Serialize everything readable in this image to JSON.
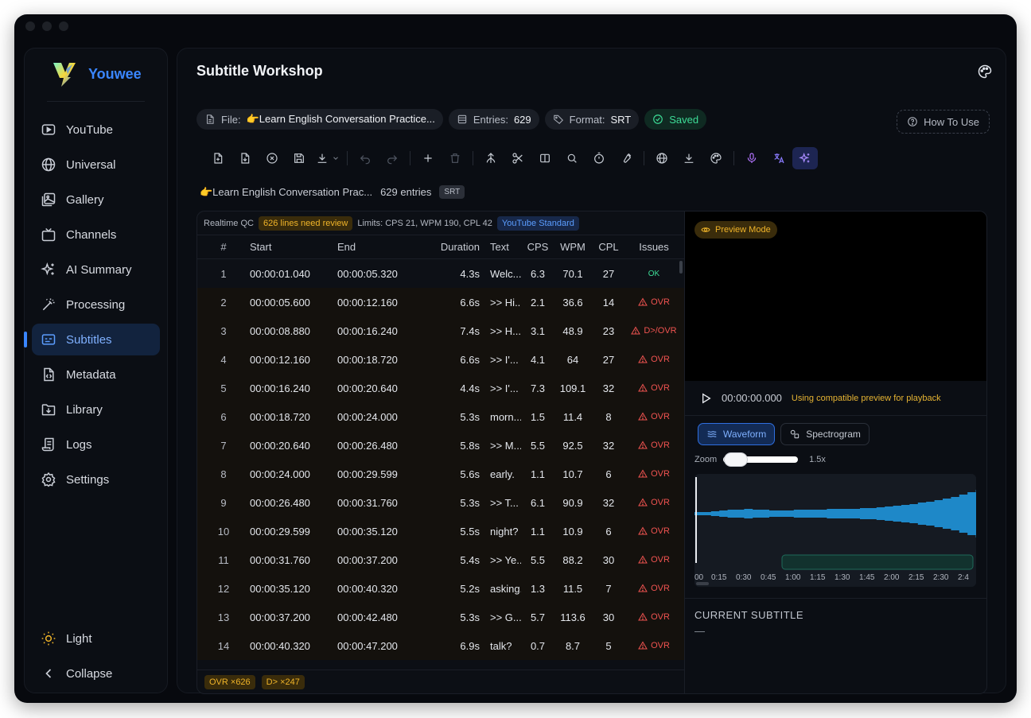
{
  "app": {
    "name": "Youwee",
    "page_title": "Subtitle Workshop"
  },
  "sidebar": {
    "items": [
      {
        "label": "YouTube",
        "icon": "play-square-icon"
      },
      {
        "label": "Universal",
        "icon": "globe-icon"
      },
      {
        "label": "Gallery",
        "icon": "image-icon"
      },
      {
        "label": "Channels",
        "icon": "tv-icon"
      },
      {
        "label": "AI Summary",
        "icon": "sparkles-icon"
      },
      {
        "label": "Processing",
        "icon": "wand-icon"
      },
      {
        "label": "Subtitles",
        "icon": "captions-icon",
        "active": true
      },
      {
        "label": "Metadata",
        "icon": "file-code-icon"
      },
      {
        "label": "Library",
        "icon": "folder-down-icon"
      },
      {
        "label": "Logs",
        "icon": "scroll-icon"
      },
      {
        "label": "Settings",
        "icon": "gear-icon"
      }
    ],
    "theme_label": "Light",
    "collapse_label": "Collapse"
  },
  "file_info": {
    "file_label": "File:",
    "file_value": "👉Learn English Conversation Practice...",
    "entries_label": "Entries:",
    "entries_value": "629",
    "format_label": "Format:",
    "format_value": "SRT",
    "status": "Saved"
  },
  "how_to_use": "How To Use",
  "subline": {
    "title": "👉Learn English Conversation Prac...",
    "count": "629 entries",
    "badge": "SRT"
  },
  "qc": {
    "label": "Realtime QC",
    "warning": "626 lines need review",
    "limits": "Limits: CPS 21, WPM 190, CPL 42",
    "standard": "YouTube Standard"
  },
  "table": {
    "headers": {
      "n": "#",
      "start": "Start",
      "end": "End",
      "duration": "Duration",
      "text": "Text",
      "cps": "CPS",
      "wpm": "WPM",
      "cpl": "CPL",
      "issues": "Issues"
    },
    "rows": [
      {
        "n": "1",
        "start": "00:00:01.040",
        "end": "00:00:05.320",
        "duration": "4.3s",
        "text": "Welc...",
        "cps": "6.3",
        "wpm": "70.1",
        "cpl": "27",
        "issue": "OK"
      },
      {
        "n": "2",
        "start": "00:00:05.600",
        "end": "00:00:12.160",
        "duration": "6.6s",
        "text": ">> Hi...",
        "cps": "2.1",
        "wpm": "36.6",
        "cpl": "14",
        "issue": "OVR"
      },
      {
        "n": "3",
        "start": "00:00:08.880",
        "end": "00:00:16.240",
        "duration": "7.4s",
        "text": ">> H...",
        "cps": "3.1",
        "wpm": "48.9",
        "cpl": "23",
        "issue": "D>/OVR"
      },
      {
        "n": "4",
        "start": "00:00:12.160",
        "end": "00:00:18.720",
        "duration": "6.6s",
        "text": ">> I'...",
        "cps": "4.1",
        "wpm": "64",
        "cpl": "27",
        "issue": "OVR"
      },
      {
        "n": "5",
        "start": "00:00:16.240",
        "end": "00:00:20.640",
        "duration": "4.4s",
        "text": ">> I'...",
        "cps": "7.3",
        "wpm": "109.1",
        "cpl": "32",
        "issue": "OVR"
      },
      {
        "n": "6",
        "start": "00:00:18.720",
        "end": "00:00:24.000",
        "duration": "5.3s",
        "text": "morn...",
        "cps": "1.5",
        "wpm": "11.4",
        "cpl": "8",
        "issue": "OVR"
      },
      {
        "n": "7",
        "start": "00:00:20.640",
        "end": "00:00:26.480",
        "duration": "5.8s",
        "text": ">> M...",
        "cps": "5.5",
        "wpm": "92.5",
        "cpl": "32",
        "issue": "OVR"
      },
      {
        "n": "8",
        "start": "00:00:24.000",
        "end": "00:00:29.599",
        "duration": "5.6s",
        "text": "early.",
        "cps": "1.1",
        "wpm": "10.7",
        "cpl": "6",
        "issue": "OVR"
      },
      {
        "n": "9",
        "start": "00:00:26.480",
        "end": "00:00:31.760",
        "duration": "5.3s",
        "text": ">> T...",
        "cps": "6.1",
        "wpm": "90.9",
        "cpl": "32",
        "issue": "OVR"
      },
      {
        "n": "10",
        "start": "00:00:29.599",
        "end": "00:00:35.120",
        "duration": "5.5s",
        "text": "night?",
        "cps": "1.1",
        "wpm": "10.9",
        "cpl": "6",
        "issue": "OVR"
      },
      {
        "n": "11",
        "start": "00:00:31.760",
        "end": "00:00:37.200",
        "duration": "5.4s",
        "text": ">> Ye...",
        "cps": "5.5",
        "wpm": "88.2",
        "cpl": "30",
        "issue": "OVR"
      },
      {
        "n": "12",
        "start": "00:00:35.120",
        "end": "00:00:40.320",
        "duration": "5.2s",
        "text": "asking.",
        "cps": "1.3",
        "wpm": "11.5",
        "cpl": "7",
        "issue": "OVR"
      },
      {
        "n": "13",
        "start": "00:00:37.200",
        "end": "00:00:42.480",
        "duration": "5.3s",
        "text": ">> G...",
        "cps": "5.7",
        "wpm": "113.6",
        "cpl": "30",
        "issue": "OVR"
      },
      {
        "n": "14",
        "start": "00:00:40.320",
        "end": "00:00:47.200",
        "duration": "6.9s",
        "text": "talk?",
        "cps": "0.7",
        "wpm": "8.7",
        "cpl": "5",
        "issue": "OVR"
      }
    ]
  },
  "footer_badges": [
    "OVR ×626",
    "D> ×247"
  ],
  "preview": {
    "mode": "Preview Mode",
    "time": "00:00:00.000",
    "note": "Using compatible preview for playback",
    "tabs": [
      "Waveform",
      "Spectrogram"
    ],
    "zoom_label": "Zoom",
    "zoom_value": "1.5x",
    "timeline": [
      "00",
      "0:15",
      "0:30",
      "0:45",
      "1:00",
      "1:15",
      "1:30",
      "1:45",
      "2:00",
      "2:15",
      "2:30",
      "2:4"
    ],
    "current_subtitle_label": "CURRENT SUBTITLE",
    "current_subtitle_value": "—"
  },
  "colors": {
    "accent": "#3a86ff",
    "warning": "#f0b429",
    "error": "#ef5350",
    "ok": "#3ddc97",
    "waveform": "#1e88c8"
  }
}
